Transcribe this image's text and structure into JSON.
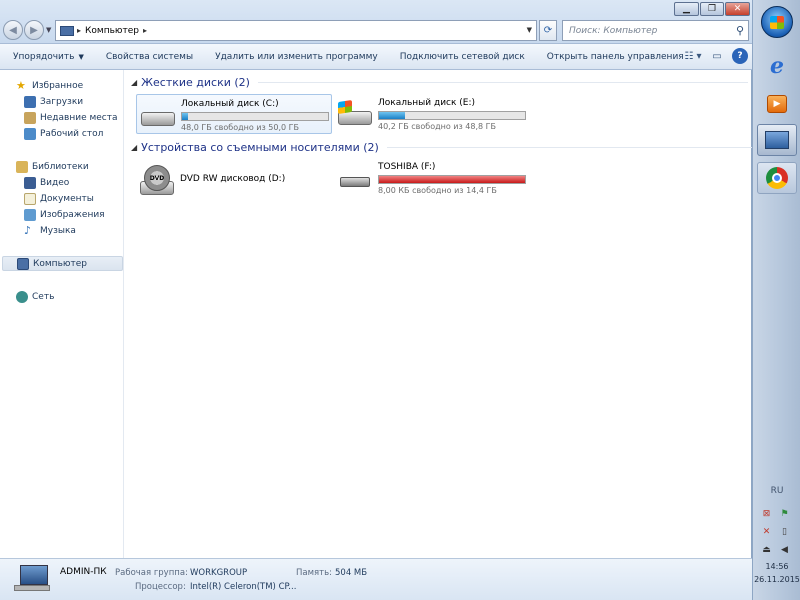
{
  "address": {
    "location": "Компьютер"
  },
  "search": {
    "placeholder": "Поиск: Компьютер"
  },
  "toolbar": {
    "organize": "Упорядочить",
    "system_properties": "Свойства системы",
    "uninstall": "Удалить или изменить программу",
    "map_drive": "Подключить сетевой диск",
    "control_panel": "Открыть панель управления"
  },
  "sidebar": {
    "favorites": "Избранное",
    "downloads": "Загрузки",
    "recent": "Недавние места",
    "desktop": "Рабочий стол",
    "libraries": "Библиотеки",
    "video": "Видео",
    "documents": "Документы",
    "pictures": "Изображения",
    "music": "Музыка",
    "computer": "Компьютер",
    "network": "Сеть"
  },
  "groups": {
    "hdd": "Жесткие диски (2)",
    "removable": "Устройства со съемными носителями (2)"
  },
  "drives": [
    {
      "name": "Локальный диск (C:)",
      "free": "48,0 ГБ свободно из 50,0 ГБ",
      "used_fraction": 0.04
    },
    {
      "name": "Локальный диск (E:)",
      "free": "40,2 ГБ свободно из 48,8 ГБ",
      "used_fraction": 0.18
    },
    {
      "name": "DVD RW дисковод (D:)"
    },
    {
      "name": "TOSHIBA (F:)",
      "free": "8,00 КБ свободно из 14,4 ГБ",
      "used_fraction": 1.0
    }
  ],
  "details": {
    "name": "ADMIN-ПК",
    "workgroup_label": "Рабочая группа:",
    "workgroup": "WORKGROUP",
    "memory_label": "Память:",
    "memory": "504 МБ",
    "cpu_label": "Процессор:",
    "cpu": "Intel(R) Celeron(TM) CP..."
  },
  "taskbar": {
    "language": "RU",
    "time": "14:56",
    "date": "26.11.2015"
  },
  "colors": {
    "accent": "#1e3287",
    "bar_ok": "#1a7fc6",
    "bar_full": "#c81919"
  }
}
